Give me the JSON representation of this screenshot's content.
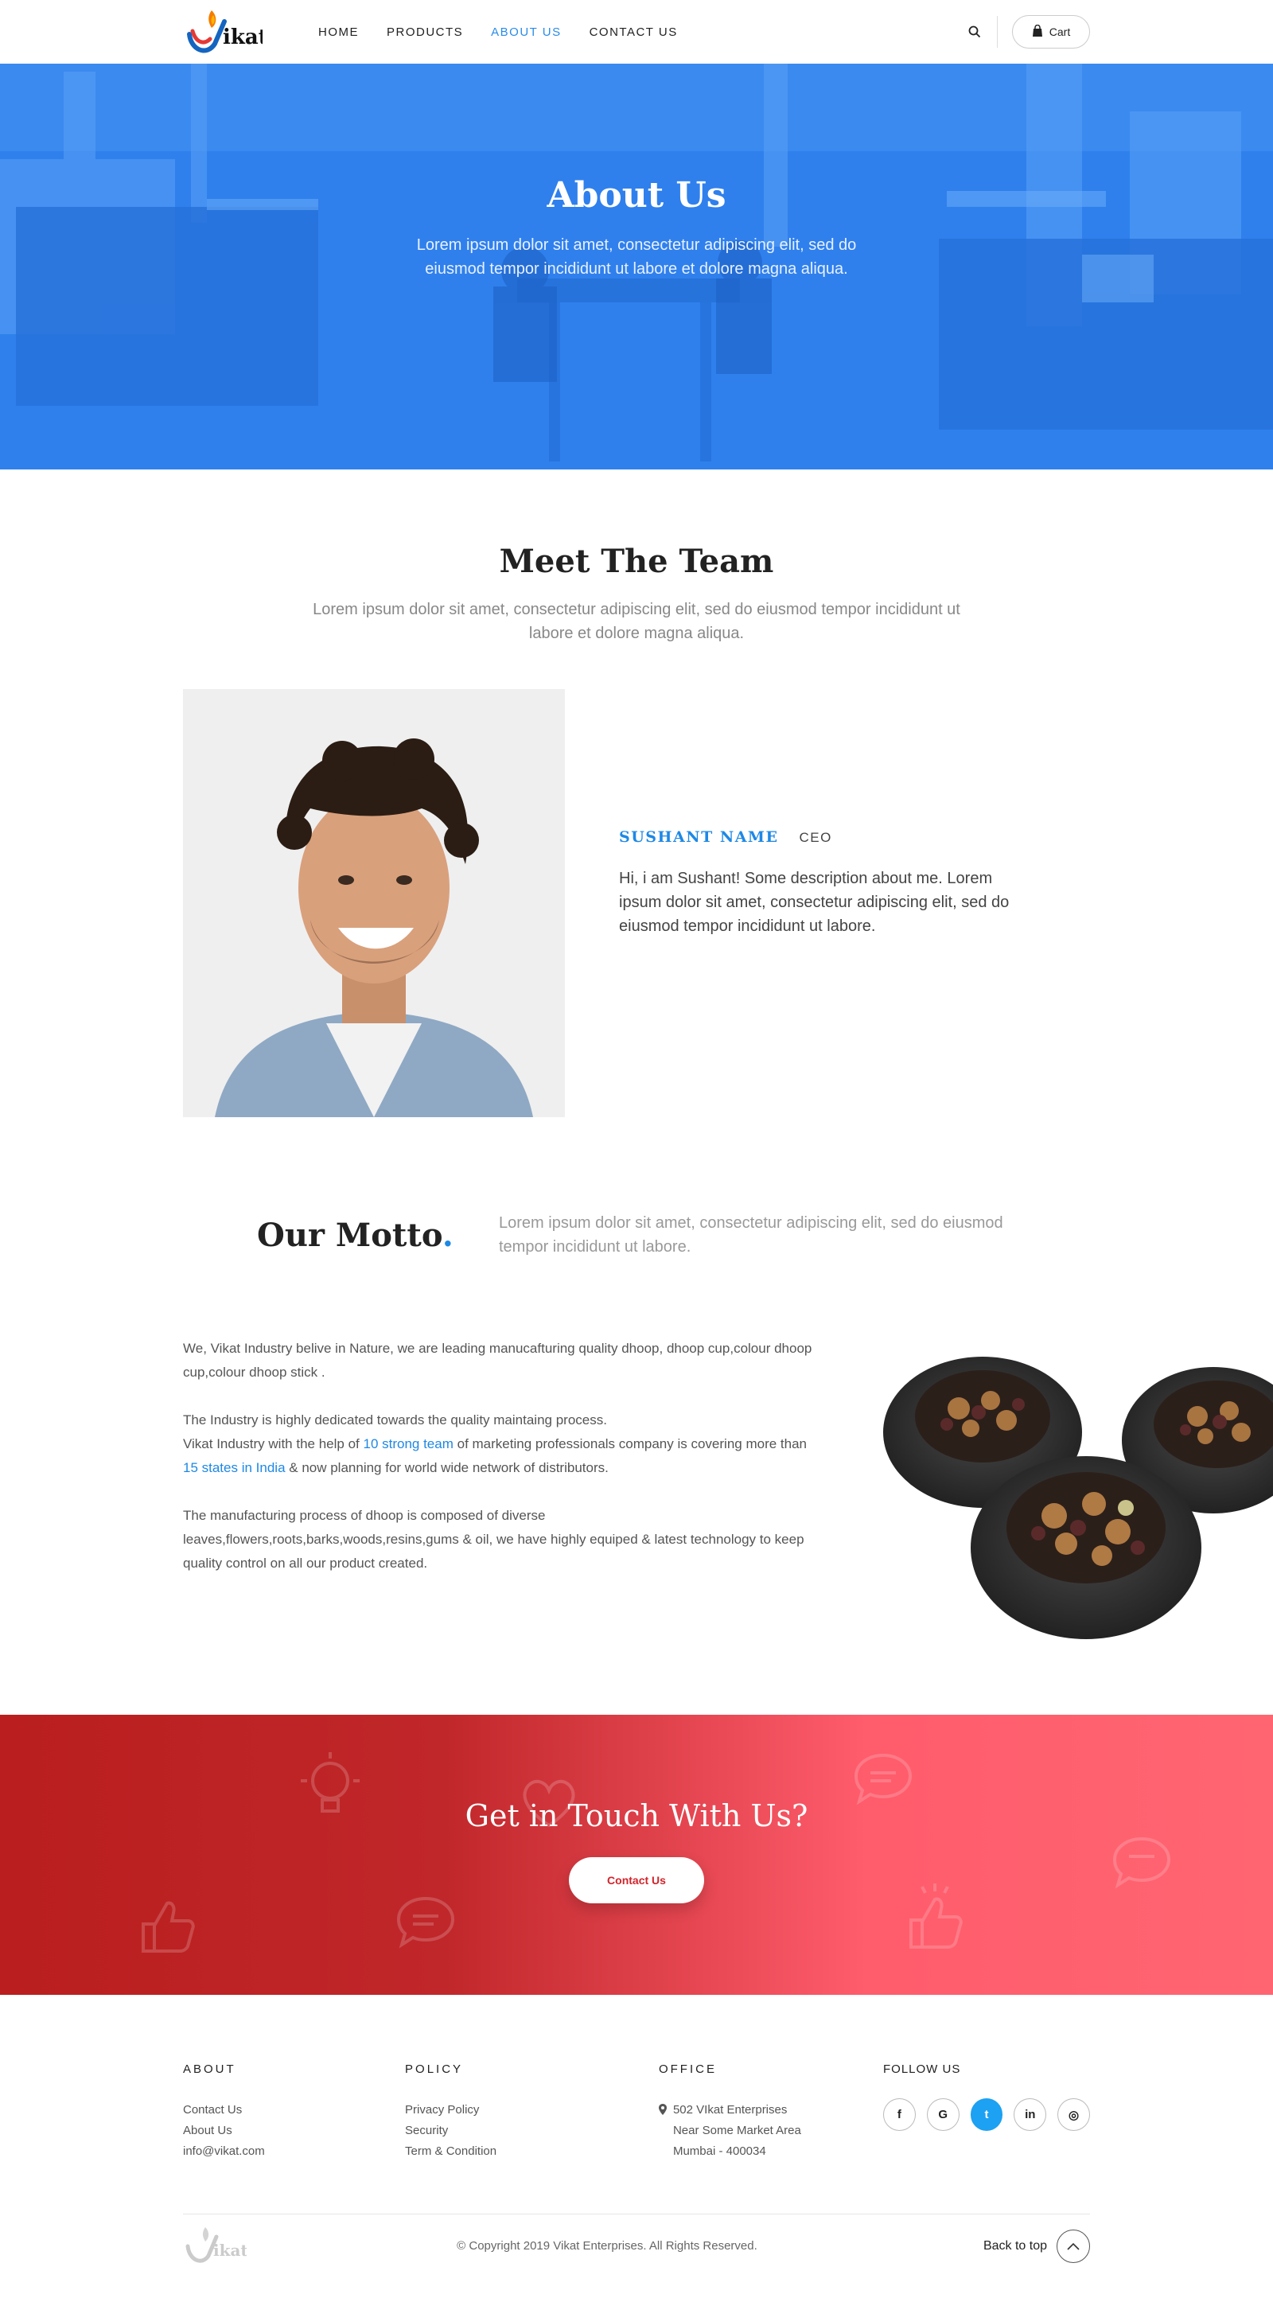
{
  "header": {
    "logo_text": "ikat",
    "nav": [
      {
        "label": "HOME",
        "active": false
      },
      {
        "label": "PRODUCTS",
        "active": false
      },
      {
        "label": "ABOUT US",
        "active": true
      },
      {
        "label": "CONTACT US",
        "active": false
      }
    ],
    "cart_label": "Cart"
  },
  "hero": {
    "title": "About Us",
    "subtitle": "Lorem ipsum dolor sit amet, consectetur adipiscing elit, sed do eiusmod tempor incididunt ut labore et dolore magna aliqua."
  },
  "team": {
    "title": "Meet The Team",
    "subtitle": "Lorem ipsum dolor sit amet, consectetur adipiscing elit, sed do eiusmod tempor incididunt ut labore et dolore magna aliqua.",
    "member": {
      "name": "SUSHANT NAME",
      "role": "CEO",
      "description": "Hi, i am Sushant! Some description about me. Lorem ipsum dolor sit amet, consectetur adipiscing elit, sed do eiusmod tempor incididunt ut labore."
    }
  },
  "motto": {
    "title": "Our Motto",
    "dot": ".",
    "text": "Lorem ipsum dolor sit amet, consectetur adipiscing elit, sed do eiusmod tempor incididunt ut labore."
  },
  "about": {
    "p1": "We, Vikat Industry belive in Nature, we are leading manucafturing  quality dhoop, dhoop cup,colour dhoop cup,colour dhoop stick .",
    "p2_line1": "The Industry is highly dedicated towards the quality maintaing process.",
    "p2_a": "Vikat Industry with the help of ",
    "p2_hl1": "10 strong team",
    "p2_b": " of marketing professionals company is covering more than ",
    "p2_hl2": "15 states in India",
    "p2_c": " & now planning for world wide network of distributors.",
    "p3": "The manufacturing process of dhoop is composed of diverse leaves,flowers,roots,barks,woods,resins,gums & oil, we have highly equiped & latest technology to keep quality control on all our product created."
  },
  "cta": {
    "title": "Get in Touch With Us?",
    "button": "Contact Us"
  },
  "footer": {
    "about_title": "ABOUT",
    "about_links": [
      "Contact Us",
      "About Us",
      "info@vikat.com"
    ],
    "policy_title": "POLICY",
    "policy_links": [
      "Privacy Policy",
      "Security",
      "Term & Condition"
    ],
    "office_title": "OFFICE",
    "office_lines": [
      "502 VIkat Enterprises",
      "Near Some Market Area",
      "Mumbai - 400034"
    ],
    "follow_title": "FOLLOW US",
    "socials": [
      {
        "name": "facebook",
        "glyph": "f"
      },
      {
        "name": "google",
        "glyph": "G"
      },
      {
        "name": "twitter",
        "glyph": "t"
      },
      {
        "name": "linkedin",
        "glyph": "in"
      },
      {
        "name": "instagram",
        "glyph": "◎"
      }
    ],
    "copyright": "© Copyright 2019 Vikat Enterprises. All Rights Reserved.",
    "back_to_top": "Back to top"
  },
  "colors": {
    "accent": "#1e88e5",
    "hero_blue": "#2f80ed",
    "cta_red": "#ba1e1e",
    "cta_pink": "#ff6571",
    "twitter": "#1da1f2"
  }
}
